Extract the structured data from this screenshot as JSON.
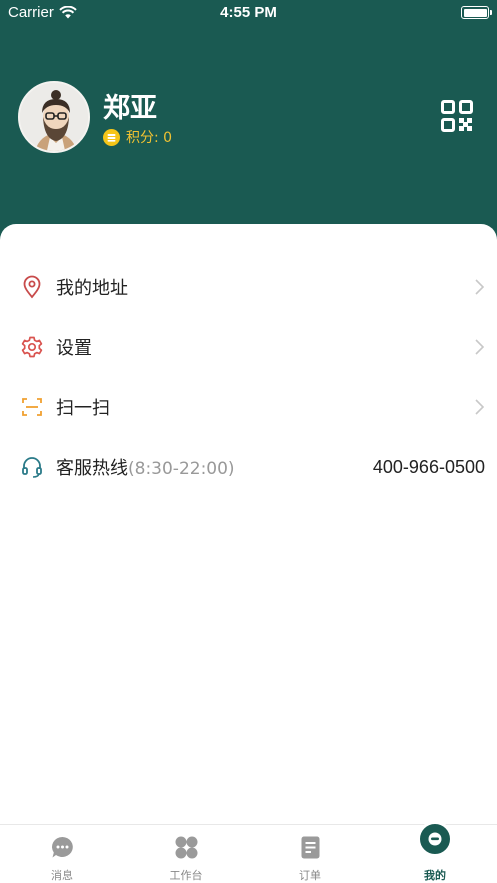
{
  "status_bar": {
    "carrier": "Carrier",
    "time": "4:55 PM"
  },
  "profile": {
    "name": "郑亚",
    "points_label": "积分: 0"
  },
  "menu": {
    "items": [
      {
        "label": "我的地址"
      },
      {
        "label": "设置"
      },
      {
        "label": "扫一扫"
      }
    ],
    "hotline": {
      "label": "客服热线",
      "hours": "(8:30-22:00)",
      "phone": "400-966-0500"
    }
  },
  "tabbar": {
    "tabs": [
      {
        "label": "消息"
      },
      {
        "label": "工作台"
      },
      {
        "label": "订单"
      },
      {
        "label": "我的"
      }
    ]
  },
  "colors": {
    "header_bg": "#1a5a52",
    "points": "#f1c232",
    "accent_red": "#d9534f",
    "accent_orange": "#f0a030",
    "hotline_icon": "#2a7a88"
  }
}
